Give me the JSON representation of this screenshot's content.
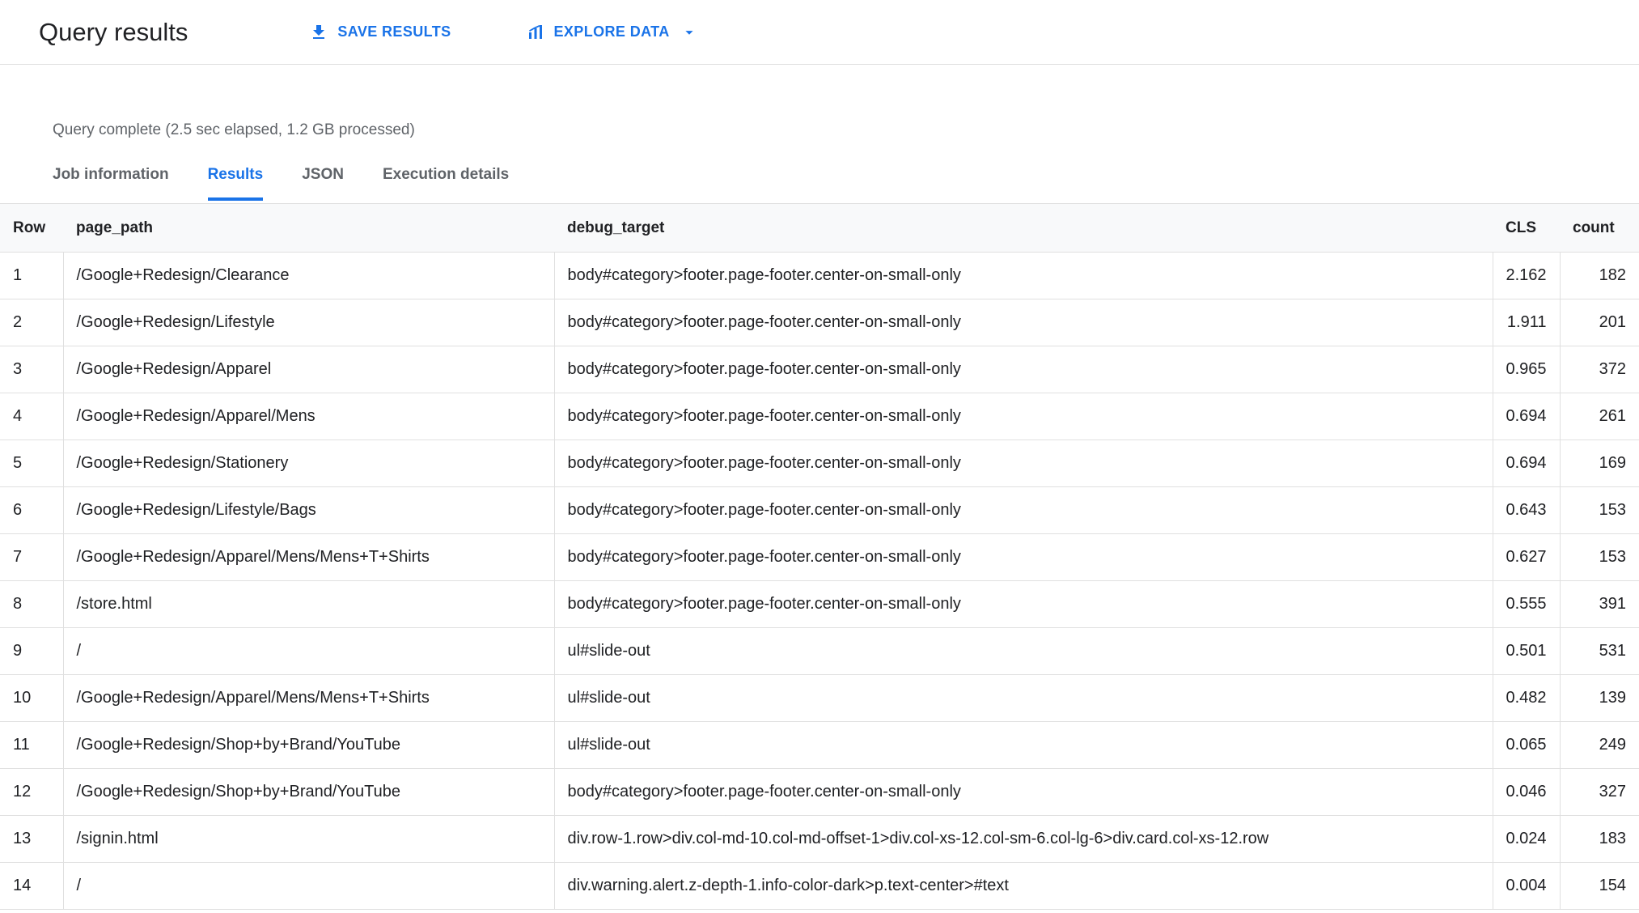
{
  "header": {
    "title": "Query results",
    "save_results_label": "SAVE RESULTS",
    "explore_data_label": "EXPLORE DATA"
  },
  "status_text": "Query complete (2.5 sec elapsed, 1.2 GB processed)",
  "tabs": [
    {
      "label": "Job information"
    },
    {
      "label": "Results"
    },
    {
      "label": "JSON"
    },
    {
      "label": "Execution details"
    }
  ],
  "table": {
    "columns": [
      "Row",
      "page_path",
      "debug_target",
      "CLS",
      "count"
    ],
    "rows": [
      {
        "row": "1",
        "page_path": "/Google+Redesign/Clearance",
        "debug_target": "body#category>footer.page-footer.center-on-small-only",
        "cls": "2.162",
        "count": "182"
      },
      {
        "row": "2",
        "page_path": "/Google+Redesign/Lifestyle",
        "debug_target": "body#category>footer.page-footer.center-on-small-only",
        "cls": "1.911",
        "count": "201"
      },
      {
        "row": "3",
        "page_path": "/Google+Redesign/Apparel",
        "debug_target": "body#category>footer.page-footer.center-on-small-only",
        "cls": "0.965",
        "count": "372"
      },
      {
        "row": "4",
        "page_path": "/Google+Redesign/Apparel/Mens",
        "debug_target": "body#category>footer.page-footer.center-on-small-only",
        "cls": "0.694",
        "count": "261"
      },
      {
        "row": "5",
        "page_path": "/Google+Redesign/Stationery",
        "debug_target": "body#category>footer.page-footer.center-on-small-only",
        "cls": "0.694",
        "count": "169"
      },
      {
        "row": "6",
        "page_path": "/Google+Redesign/Lifestyle/Bags",
        "debug_target": "body#category>footer.page-footer.center-on-small-only",
        "cls": "0.643",
        "count": "153"
      },
      {
        "row": "7",
        "page_path": "/Google+Redesign/Apparel/Mens/Mens+T+Shirts",
        "debug_target": "body#category>footer.page-footer.center-on-small-only",
        "cls": "0.627",
        "count": "153"
      },
      {
        "row": "8",
        "page_path": "/store.html",
        "debug_target": "body#category>footer.page-footer.center-on-small-only",
        "cls": "0.555",
        "count": "391"
      },
      {
        "row": "9",
        "page_path": "/",
        "debug_target": "ul#slide-out",
        "cls": "0.501",
        "count": "531"
      },
      {
        "row": "10",
        "page_path": "/Google+Redesign/Apparel/Mens/Mens+T+Shirts",
        "debug_target": "ul#slide-out",
        "cls": "0.482",
        "count": "139"
      },
      {
        "row": "11",
        "page_path": "/Google+Redesign/Shop+by+Brand/YouTube",
        "debug_target": "ul#slide-out",
        "cls": "0.065",
        "count": "249"
      },
      {
        "row": "12",
        "page_path": "/Google+Redesign/Shop+by+Brand/YouTube",
        "debug_target": "body#category>footer.page-footer.center-on-small-only",
        "cls": "0.046",
        "count": "327"
      },
      {
        "row": "13",
        "page_path": "/signin.html",
        "debug_target": "div.row-1.row>div.col-md-10.col-md-offset-1>div.col-xs-12.col-sm-6.col-lg-6>div.card.col-xs-12.row",
        "cls": "0.024",
        "count": "183"
      },
      {
        "row": "14",
        "page_path": "/",
        "debug_target": "div.warning.alert.z-depth-1.info-color-dark>p.text-center>#text",
        "cls": "0.004",
        "count": "154"
      }
    ]
  },
  "colors": {
    "accent": "#1a73e8"
  }
}
